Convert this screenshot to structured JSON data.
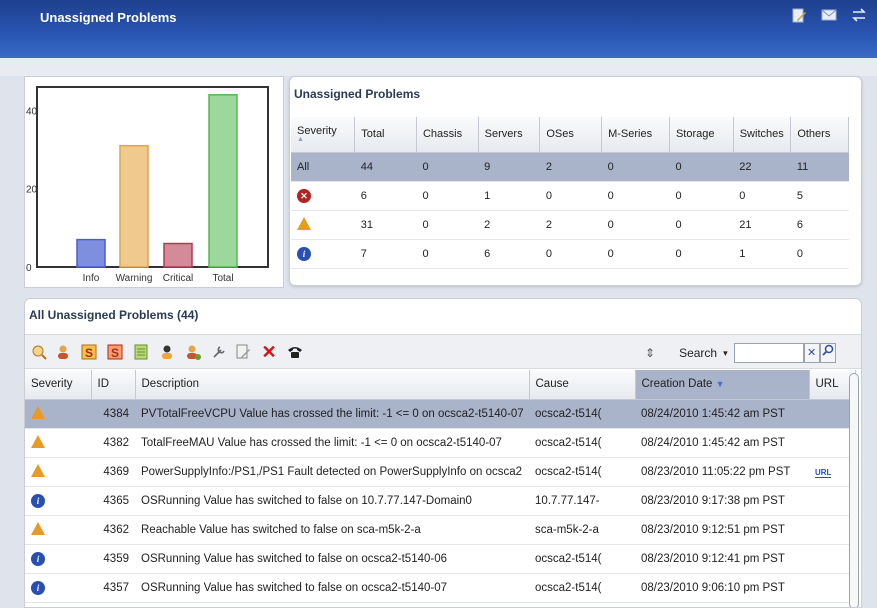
{
  "header": {
    "title": "Unassigned Problems",
    "icons": [
      "edit-icon",
      "mail-icon",
      "swap-icon"
    ]
  },
  "chart_data": {
    "type": "bar",
    "categories": [
      "Info",
      "Warning",
      "Critical",
      "Total"
    ],
    "values": [
      7,
      31,
      6,
      44
    ],
    "ylim": [
      0,
      46
    ],
    "yticks": [
      "0",
      "20",
      "40"
    ],
    "colors": [
      "#7f8fe0",
      "#f0c98e",
      "#d58a9a",
      "#9bd89a"
    ],
    "edge_colors": [
      "#4a5fd0",
      "#e0a64d",
      "#b23a4f",
      "#59b556"
    ]
  },
  "summary": {
    "title": "Unassigned Problems",
    "columns": [
      "Severity",
      "Total",
      "Chassis",
      "Servers",
      "OSes",
      "M-Series",
      "Storage",
      "Switches",
      "Others"
    ],
    "rows": [
      {
        "sev": "All",
        "vals": [
          "44",
          "0",
          "9",
          "2",
          "0",
          "0",
          "22",
          "11"
        ]
      },
      {
        "sev": "critical",
        "vals": [
          "6",
          "0",
          "1",
          "0",
          "0",
          "0",
          "0",
          "5"
        ]
      },
      {
        "sev": "warning",
        "vals": [
          "31",
          "0",
          "2",
          "2",
          "0",
          "0",
          "21",
          "6"
        ]
      },
      {
        "sev": "info",
        "vals": [
          "7",
          "0",
          "6",
          "0",
          "0",
          "0",
          "1",
          "0"
        ]
      }
    ]
  },
  "problems": {
    "title": "All Unassigned Problems (44)",
    "search_label": "Search",
    "columns": [
      "Severity",
      "ID",
      "Description",
      "Cause",
      "Creation Date",
      "URL"
    ],
    "rows": [
      {
        "sev": "warning",
        "id": "4384",
        "desc": "PVTotalFreeVCPU Value has crossed the limit: -1 <= 0 on ocsca2-t5140-07",
        "cause": "ocsca2-t514(",
        "date": "08/24/2010 1:45:42 am PST",
        "url": ""
      },
      {
        "sev": "warning",
        "id": "4382",
        "desc": "TotalFreeMAU Value has crossed the limit: -1 <= 0 on ocsca2-t5140-07",
        "cause": "ocsca2-t514(",
        "date": "08/24/2010 1:45:42 am PST",
        "url": ""
      },
      {
        "sev": "warning",
        "id": "4369",
        "desc": "PowerSupplyInfo:/PS1,/PS1 Fault detected on PowerSupplyInfo on ocsca2",
        "cause": "ocsca2-t514(",
        "date": "08/23/2010 11:05:22 pm PST",
        "url": "URL"
      },
      {
        "sev": "info",
        "id": "4365",
        "desc": "OSRunning Value has switched to false on 10.7.77.147-Domain0",
        "cause": "10.7.77.147-",
        "date": "08/23/2010 9:17:38 pm PST",
        "url": ""
      },
      {
        "sev": "warning",
        "id": "4362",
        "desc": "Reachable Value has switched to false on sca-m5k-2-a",
        "cause": "sca-m5k-2-a",
        "date": "08/23/2010 9:12:51 pm PST",
        "url": ""
      },
      {
        "sev": "info",
        "id": "4359",
        "desc": "OSRunning Value has switched to false on ocsca2-t5140-06",
        "cause": "ocsca2-t514(",
        "date": "08/23/2010 9:12:41 pm PST",
        "url": ""
      },
      {
        "sev": "info",
        "id": "4357",
        "desc": "OSRunning Value has switched to false on ocsca2-t5140-07",
        "cause": "ocsca2-t514(",
        "date": "08/23/2010 9:06:10 pm PST",
        "url": ""
      }
    ]
  }
}
